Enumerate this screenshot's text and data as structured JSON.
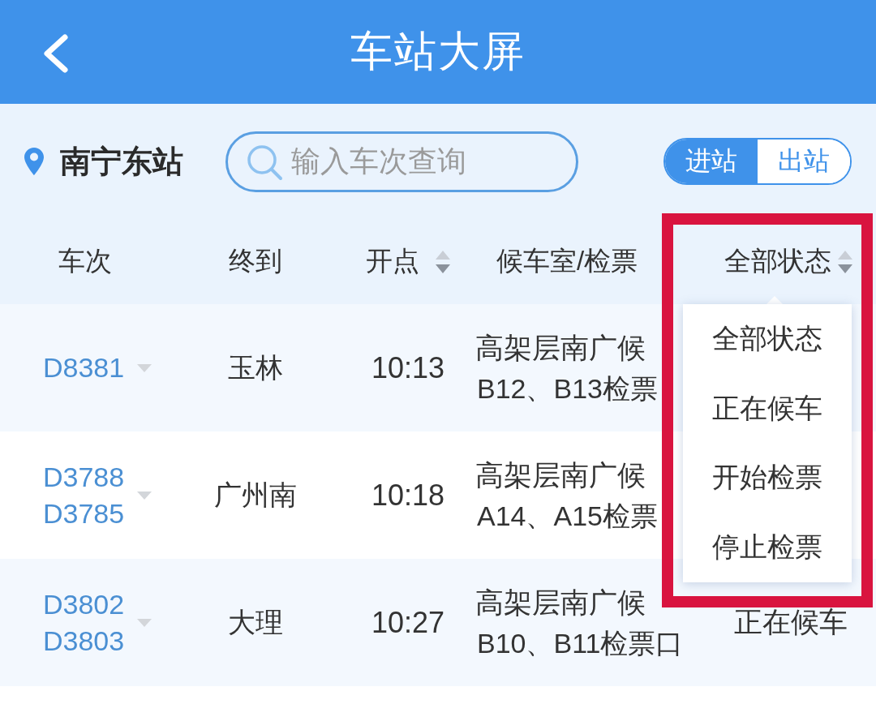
{
  "top_bar": {
    "title": "车站大屏"
  },
  "station": {
    "name": "南宁东站"
  },
  "search": {
    "placeholder": "输入车次查询"
  },
  "direction_tabs": [
    {
      "label": "进站",
      "selected": true
    },
    {
      "label": "出站",
      "selected": false
    }
  ],
  "table": {
    "columns": [
      {
        "label": "车次",
        "sortable": false
      },
      {
        "label": "终到",
        "sortable": false
      },
      {
        "label": "开点",
        "sortable": true
      },
      {
        "label": "候车室/检票",
        "sortable": false
      },
      {
        "label": "全部状态",
        "sortable": true
      }
    ],
    "rows": [
      {
        "trains": [
          "D8381"
        ],
        "destination": "玉林",
        "departure": "10:13",
        "waiting_room": [
          "高架层南广候",
          "B12、B13检票"
        ]
      },
      {
        "trains": [
          "D3788",
          "D3785"
        ],
        "destination": "广州南",
        "departure": "10:18",
        "waiting_room": [
          "高架层南广候",
          "A14、A15检票"
        ]
      },
      {
        "trains": [
          "D3802",
          "D3803"
        ],
        "destination": "大理",
        "departure": "10:27",
        "waiting_room": [
          "高架层南广候",
          "B10、B11检票口"
        ],
        "status": "正在候车"
      }
    ]
  },
  "status_menu": {
    "items": [
      "全部状态",
      "正在候车",
      "开始检票",
      "停止检票"
    ]
  }
}
